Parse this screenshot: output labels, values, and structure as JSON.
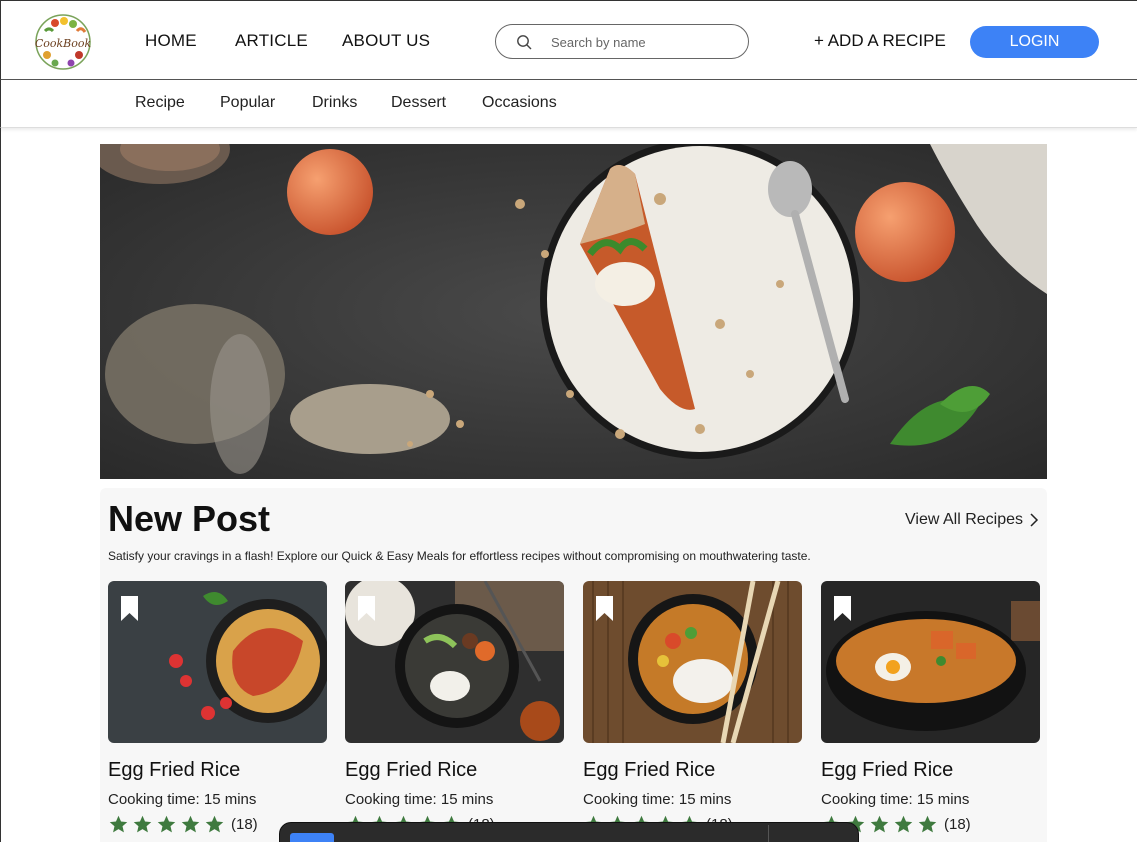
{
  "header": {
    "brand": "CookBook",
    "nav": [
      "HOME",
      "ARTICLE",
      "ABOUT US"
    ],
    "search_placeholder": "Search by name",
    "add_recipe": "+ ADD A RECIPE",
    "login": "LOGIN"
  },
  "subnav": [
    "Recipe",
    "Popular",
    "Drinks",
    "Dessert",
    "Occasions"
  ],
  "section": {
    "title": "New Post",
    "view_all": "View All Recipes",
    "description": "Satisfy your cravings in a flash! Explore our Quick & Easy Meals for effortless recipes without compromising on mouthwatering taste."
  },
  "cards": [
    {
      "title": "Egg Fried Rice",
      "time": "Cooking time: 15 mins",
      "stars": 5,
      "count": "(18)"
    },
    {
      "title": "Egg Fried Rice",
      "time": "Cooking time: 15 mins",
      "stars": 5,
      "count": "(18)"
    },
    {
      "title": "Egg Fried Rice",
      "time": "Cooking time: 15 mins",
      "stars": 5,
      "count": "(18)"
    },
    {
      "title": "Egg Fried Rice",
      "time": "Cooking time: 15 mins",
      "stars": 5,
      "count": "(18)"
    }
  ],
  "colors": {
    "accent": "#3d82f6",
    "star": "#3f7a3f",
    "section_bg": "#f7f7f7"
  }
}
